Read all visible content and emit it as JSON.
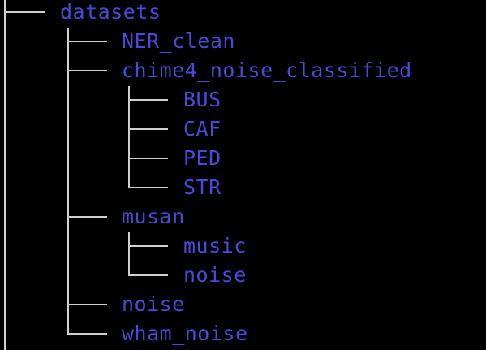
{
  "tree": {
    "root": "datasets",
    "items": [
      {
        "name": "NER_clean"
      },
      {
        "name": "chime4_noise_classified",
        "children": [
          {
            "name": "BUS"
          },
          {
            "name": "CAF"
          },
          {
            "name": "PED"
          },
          {
            "name": "STR"
          }
        ]
      },
      {
        "name": "musan",
        "children": [
          {
            "name": "music"
          },
          {
            "name": "noise"
          }
        ]
      },
      {
        "name": "noise"
      },
      {
        "name": "wham_noise"
      }
    ]
  },
  "colors": {
    "background": "#000000",
    "directory": "#4a4ad8",
    "tree_line": "#cfcfcf"
  }
}
